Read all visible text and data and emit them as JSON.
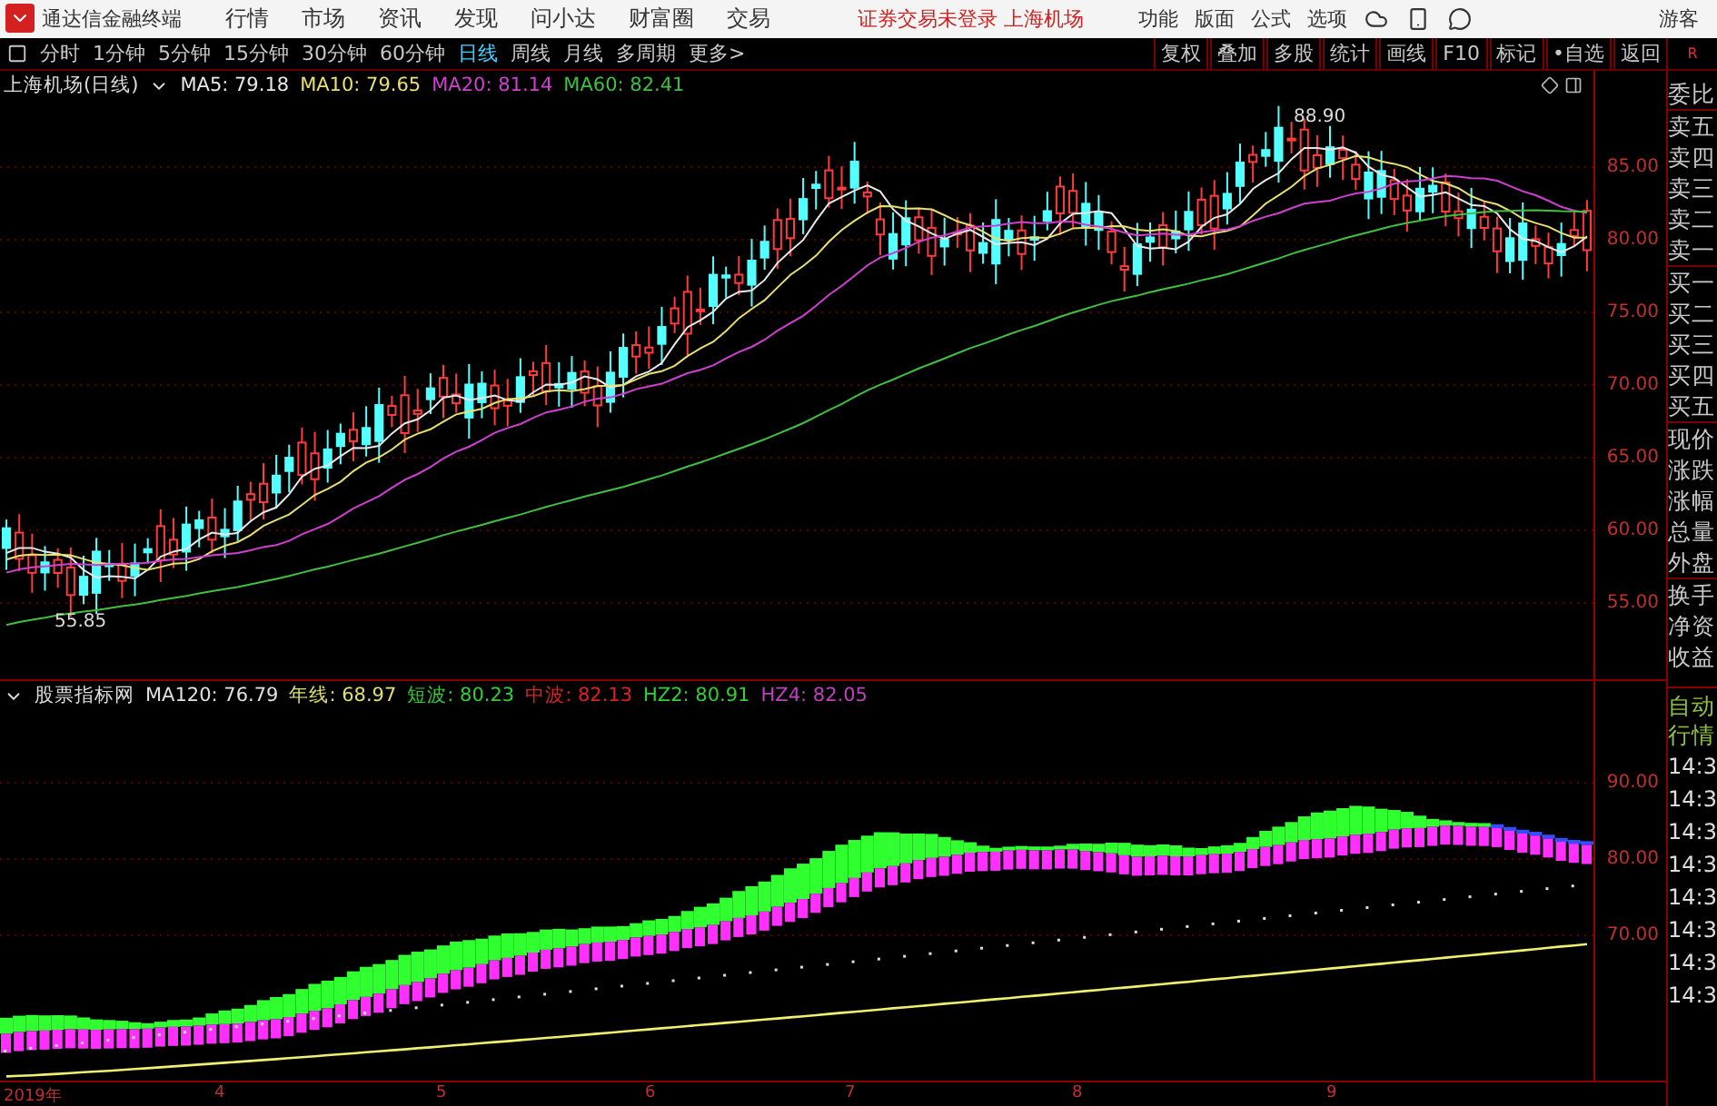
{
  "menu_bar": {
    "app_title": "通达信金融终端",
    "items": [
      "行情",
      "市场",
      "资讯",
      "发现",
      "问小达",
      "财富圈",
      "交易"
    ],
    "notice": "证券交易未登录 上海机场",
    "tools": [
      "功能",
      "版面",
      "公式",
      "选项"
    ],
    "user": "游客"
  },
  "toolbar": {
    "periods": [
      {
        "label": "分时",
        "selected": false
      },
      {
        "label": "1分钟",
        "selected": false
      },
      {
        "label": "5分钟",
        "selected": false
      },
      {
        "label": "15分钟",
        "selected": false
      },
      {
        "label": "30分钟",
        "selected": false
      },
      {
        "label": "60分钟",
        "selected": false
      },
      {
        "label": "日线",
        "selected": true
      },
      {
        "label": "周线",
        "selected": false
      },
      {
        "label": "月线",
        "selected": false
      },
      {
        "label": "多周期",
        "selected": false
      },
      {
        "label": "更多>",
        "selected": false
      }
    ],
    "actions": [
      "复权",
      "叠加",
      "多股",
      "统计",
      "画线",
      "F10",
      "标记",
      "•自选",
      "返回"
    ],
    "corner": "R"
  },
  "main_chart": {
    "title": "上海机场(日线)",
    "indicators": [
      {
        "label": "MA5: 79.18",
        "color": "#e8e8e8"
      },
      {
        "label": "MA10: 79.65",
        "color": "#e8e070"
      },
      {
        "label": "MA20: 81.14",
        "color": "#d040d0"
      },
      {
        "label": "MA60: 82.41",
        "color": "#40c040"
      }
    ],
    "high_marker": "88.90",
    "low_marker": "55.85",
    "price_axis": [
      "85.00",
      "80.00",
      "75.00",
      "70.00",
      "65.00",
      "60.00",
      "55.00"
    ]
  },
  "indicator_chart": {
    "title": "股票指标网",
    "indicators": [
      {
        "label": "MA120: 76.79",
        "color": "#e0e0e0"
      },
      {
        "label": "年线: 68.97",
        "color": "#e0e070"
      },
      {
        "label": "短波: 80.23",
        "color": "#30d030"
      },
      {
        "label": "中波: 82.13",
        "color": "#e02020"
      },
      {
        "label": "HZ2: 80.91",
        "color": "#30d030"
      },
      {
        "label": "HZ4: 82.05",
        "color": "#c040c0"
      }
    ],
    "axis": [
      "90.00",
      "80.00",
      "70.00"
    ]
  },
  "date_axis": [
    "2019年",
    "4",
    "5",
    "6",
    "7",
    "8",
    "9"
  ],
  "side_panel": {
    "quote_labels": [
      "委比",
      "卖五",
      "卖四",
      "卖三",
      "卖二",
      "卖一",
      "买一",
      "买二",
      "买三",
      "买四",
      "买五",
      "现价",
      "涨跌",
      "涨幅",
      "总量",
      "外盘",
      "换手",
      "净资",
      "收益"
    ],
    "tick_header": [
      "自动",
      "行情"
    ],
    "ticks": [
      "14:3",
      "14:3",
      "14:3",
      "14:3",
      "14:3",
      "14:3",
      "14:3",
      "14:3"
    ]
  }
}
